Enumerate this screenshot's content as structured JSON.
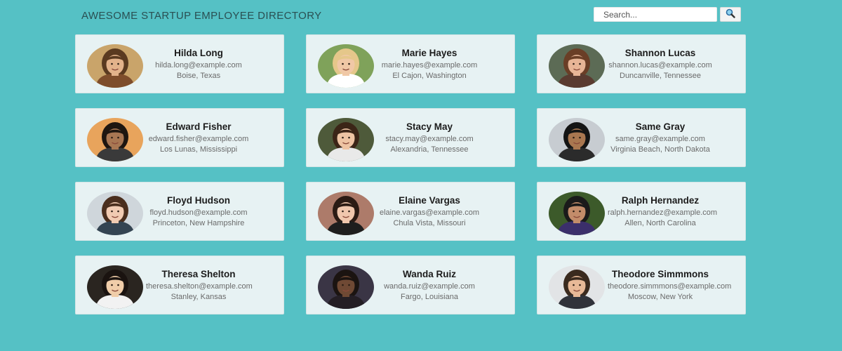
{
  "header": {
    "title": "AWESOME STARTUP EMPLOYEE DIRECTORY",
    "search_placeholder": "Search...",
    "search_icon": "magnifier-icon"
  },
  "colors": {
    "page_background": "#55c1c5",
    "card_background": "#e7f2f3",
    "title_text": "#2a4f52"
  },
  "employees": [
    {
      "name": "Hilda Long",
      "email": "hilda.long@example.com",
      "location": "Boise, Texas",
      "photo": {
        "bg": "#c9a46a",
        "skin": "#e3b38b",
        "hair": "#5a3a20",
        "shirt": "#7e4d2b"
      }
    },
    {
      "name": "Marie Hayes",
      "email": "marie.hayes@example.com",
      "location": "El Cajon, Washington",
      "photo": {
        "bg": "#7fa25a",
        "skin": "#f0c8a6",
        "hair": "#e5c78a",
        "shirt": "#ffffff"
      }
    },
    {
      "name": "Shannon Lucas",
      "email": "shannon.lucas@example.com",
      "location": "Duncanville, Tennessee",
      "photo": {
        "bg": "#5c6b55",
        "skin": "#e7b596",
        "hair": "#6a3e26",
        "shirt": "#5a3b30"
      }
    },
    {
      "name": "Edward Fisher",
      "email": "edward.fisher@example.com",
      "location": "Los Lunas, Mississippi",
      "photo": {
        "bg": "#e8a45c",
        "skin": "#a87753",
        "hair": "#1e1610",
        "shirt": "#3a3a3a"
      }
    },
    {
      "name": "Stacy May",
      "email": "stacy.may@example.com",
      "location": "Alexandria, Tennessee",
      "photo": {
        "bg": "#4e5a3a",
        "skin": "#eec4a3",
        "hair": "#3b2517",
        "shirt": "#e9e9e9"
      }
    },
    {
      "name": "Same Gray",
      "email": "same.gray@example.com",
      "location": "Virginia Beach, North Dakota",
      "photo": {
        "bg": "#c7ccd1",
        "skin": "#a97750",
        "hair": "#141414",
        "shirt": "#2b2b2b"
      }
    },
    {
      "name": "Floyd Hudson",
      "email": "floyd.hudson@example.com",
      "location": "Princeton, New Hampshire",
      "photo": {
        "bg": "#cfd6db",
        "skin": "#f1cbb2",
        "hair": "#4a2e1d",
        "shirt": "#344452"
      }
    },
    {
      "name": "Elaine Vargas",
      "email": "elaine.vargas@example.com",
      "location": "Chula Vista, Missouri",
      "photo": {
        "bg": "#ad7b6a",
        "skin": "#f0c7ad",
        "hair": "#2b1b14",
        "shirt": "#1e1e1e"
      }
    },
    {
      "name": "Ralph Hernandez",
      "email": "ralph.hernandez@example.com",
      "location": "Allen, North Carolina",
      "photo": {
        "bg": "#3c5a2a",
        "skin": "#c38c6a",
        "hair": "#1a1a1a",
        "shirt": "#3b2f6b"
      }
    },
    {
      "name": "Theresa Shelton",
      "email": "theresa.shelton@example.com",
      "location": "Stanley, Kansas",
      "photo": {
        "bg": "#2a2520",
        "skin": "#f0cda9",
        "hair": "#1a1310",
        "shirt": "#f2f2f2"
      }
    },
    {
      "name": "Wanda Ruiz",
      "email": "wanda.ruiz@example.com",
      "location": "Fargo, Louisiana",
      "photo": {
        "bg": "#3a3545",
        "skin": "#6f4934",
        "hair": "#1b1411",
        "shirt": "#241e24"
      }
    },
    {
      "name": "Theodore Simmmons",
      "email": "theodore.simmmons@example.com",
      "location": "Moscow, New York",
      "photo": {
        "bg": "#e2e4e6",
        "skin": "#e8b997",
        "hair": "#3a2a1e",
        "shirt": "#30333a"
      }
    }
  ]
}
